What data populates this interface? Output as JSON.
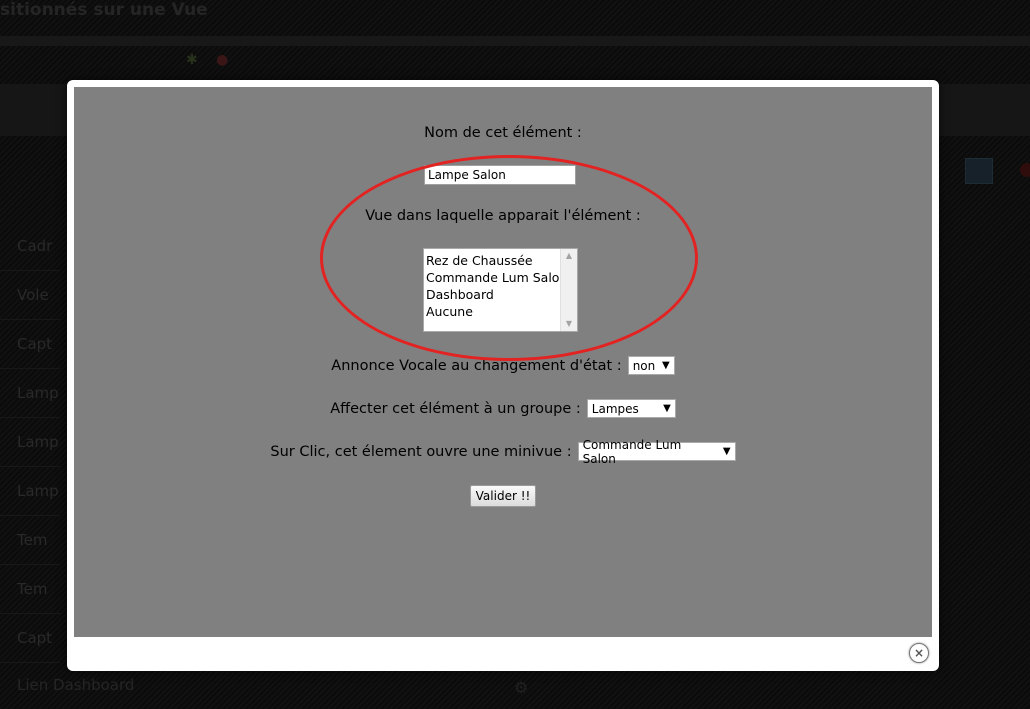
{
  "background": {
    "title_fragment": "sitionnés sur une Vue",
    "list_rows": [
      "Cadr",
      "Vole",
      "Capt",
      "Lamp",
      "Lamp",
      "Lamp",
      "Tem",
      "Tem",
      "Capt"
    ],
    "footer_text": "Lien Dashboard"
  },
  "modal": {
    "name_label": "Nom de cet élément :",
    "name_value": "Lampe Salon",
    "view_label": "Vue dans laquelle apparait l'élément :",
    "view_options": [
      "Rez de Chaussée",
      "Commande Lum Salon",
      "Dashboard",
      "Aucune"
    ],
    "announce_label": "Annonce Vocale au changement d'état :",
    "announce_value": "non",
    "group_label": "Affecter cet élément à un groupe :",
    "group_value": "Lampes",
    "click_label": "Sur Clic, cet élement ouvre une minivue :",
    "click_value": "Commande Lum Salon",
    "submit_label": "Valider !!",
    "close_symbol": "×"
  },
  "annotation": {
    "highlight_color": "#e32222"
  }
}
